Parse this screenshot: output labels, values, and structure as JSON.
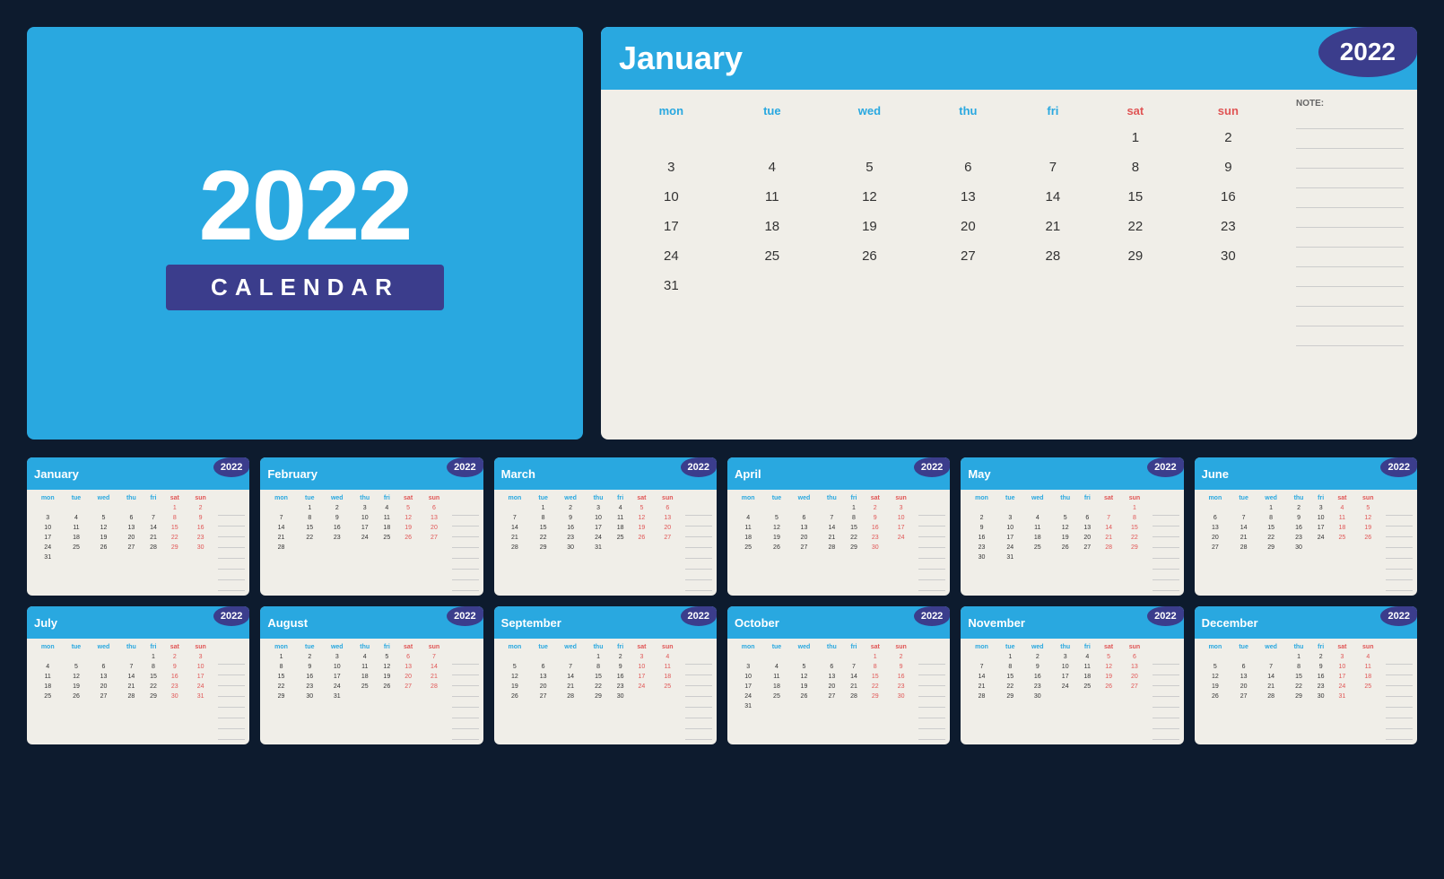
{
  "cover": {
    "year": "2022",
    "label": "CALENDAR"
  },
  "january_large": {
    "month": "January",
    "year": "2022",
    "note_label": "NOTE:",
    "days_header": [
      "mon",
      "tue",
      "wed",
      "thu",
      "fri",
      "sat",
      "sun"
    ],
    "weeks": [
      [
        "",
        "",
        "",
        "",
        "",
        "1",
        "2"
      ],
      [
        "3",
        "4",
        "5",
        "6",
        "7",
        "8",
        "9"
      ],
      [
        "10",
        "11",
        "12",
        "13",
        "14",
        "15",
        "16"
      ],
      [
        "17",
        "18",
        "19",
        "20",
        "21",
        "22",
        "23"
      ],
      [
        "24",
        "25",
        "26",
        "27",
        "28",
        "29",
        "30"
      ],
      [
        "31",
        "",
        "",
        "",
        "",
        "",
        ""
      ]
    ]
  },
  "months": [
    {
      "name": "January",
      "year": "2022",
      "weeks": [
        [
          "",
          "",
          "",
          "",
          "",
          "1",
          "2"
        ],
        [
          "3",
          "4",
          "5",
          "6",
          "7",
          "8",
          "9"
        ],
        [
          "10",
          "11",
          "12",
          "13",
          "14",
          "15",
          "16"
        ],
        [
          "17",
          "18",
          "19",
          "20",
          "21",
          "22",
          "23"
        ],
        [
          "24",
          "25",
          "26",
          "27",
          "28",
          "29",
          "30"
        ],
        [
          "31",
          "",
          "",
          "",
          "",
          "",
          ""
        ]
      ]
    },
    {
      "name": "February",
      "year": "2022",
      "weeks": [
        [
          "",
          "1",
          "2",
          "3",
          "4",
          "5",
          "6"
        ],
        [
          "7",
          "8",
          "9",
          "10",
          "11",
          "12",
          "13"
        ],
        [
          "14",
          "15",
          "16",
          "17",
          "18",
          "19",
          "20"
        ],
        [
          "21",
          "22",
          "23",
          "24",
          "25",
          "26",
          "27"
        ],
        [
          "28",
          "",
          "",
          "",
          "",
          "",
          ""
        ]
      ]
    },
    {
      "name": "March",
      "year": "2022",
      "weeks": [
        [
          "",
          "1",
          "2",
          "3",
          "4",
          "5",
          "6"
        ],
        [
          "7",
          "8",
          "9",
          "10",
          "11",
          "12",
          "13"
        ],
        [
          "14",
          "15",
          "16",
          "17",
          "18",
          "19",
          "20"
        ],
        [
          "21",
          "22",
          "23",
          "24",
          "25",
          "26",
          "27"
        ],
        [
          "28",
          "29",
          "30",
          "31",
          "",
          "",
          ""
        ]
      ]
    },
    {
      "name": "April",
      "year": "2022",
      "weeks": [
        [
          "",
          "",
          "",
          "",
          "1",
          "2",
          "3"
        ],
        [
          "4",
          "5",
          "6",
          "7",
          "8",
          "9",
          "10"
        ],
        [
          "11",
          "12",
          "13",
          "14",
          "15",
          "16",
          "17"
        ],
        [
          "18",
          "19",
          "20",
          "21",
          "22",
          "23",
          "24"
        ],
        [
          "25",
          "26",
          "27",
          "28",
          "29",
          "30",
          ""
        ]
      ]
    },
    {
      "name": "May",
      "year": "2022",
      "weeks": [
        [
          "",
          "",
          "",
          "",
          "",
          "",
          "1"
        ],
        [
          "2",
          "3",
          "4",
          "5",
          "6",
          "7",
          "8"
        ],
        [
          "9",
          "10",
          "11",
          "12",
          "13",
          "14",
          "15"
        ],
        [
          "16",
          "17",
          "18",
          "19",
          "20",
          "21",
          "22"
        ],
        [
          "23",
          "24",
          "25",
          "26",
          "27",
          "28",
          "29"
        ],
        [
          "30",
          "31",
          "",
          "",
          "",
          "",
          ""
        ]
      ]
    },
    {
      "name": "June",
      "year": "2022",
      "weeks": [
        [
          "",
          "",
          "1",
          "2",
          "3",
          "4",
          "5"
        ],
        [
          "6",
          "7",
          "8",
          "9",
          "10",
          "11",
          "12"
        ],
        [
          "13",
          "14",
          "15",
          "16",
          "17",
          "18",
          "19"
        ],
        [
          "20",
          "21",
          "22",
          "23",
          "24",
          "25",
          "26"
        ],
        [
          "27",
          "28",
          "29",
          "30",
          "",
          "",
          ""
        ]
      ]
    },
    {
      "name": "July",
      "year": "2022",
      "weeks": [
        [
          "",
          "",
          "",
          "",
          "1",
          "2",
          "3"
        ],
        [
          "4",
          "5",
          "6",
          "7",
          "8",
          "9",
          "10"
        ],
        [
          "11",
          "12",
          "13",
          "14",
          "15",
          "16",
          "17"
        ],
        [
          "18",
          "19",
          "20",
          "21",
          "22",
          "23",
          "24"
        ],
        [
          "25",
          "26",
          "27",
          "28",
          "29",
          "30",
          "31"
        ]
      ]
    },
    {
      "name": "August",
      "year": "2022",
      "weeks": [
        [
          "1",
          "2",
          "3",
          "4",
          "5",
          "6",
          "7"
        ],
        [
          "8",
          "9",
          "10",
          "11",
          "12",
          "13",
          "14"
        ],
        [
          "15",
          "16",
          "17",
          "18",
          "19",
          "20",
          "21"
        ],
        [
          "22",
          "23",
          "24",
          "25",
          "26",
          "27",
          "28"
        ],
        [
          "29",
          "30",
          "31",
          "",
          "",
          "",
          ""
        ]
      ]
    },
    {
      "name": "September",
      "year": "2022",
      "weeks": [
        [
          "",
          "",
          "",
          "1",
          "2",
          "3",
          "4"
        ],
        [
          "5",
          "6",
          "7",
          "8",
          "9",
          "10",
          "11"
        ],
        [
          "12",
          "13",
          "14",
          "15",
          "16",
          "17",
          "18"
        ],
        [
          "19",
          "20",
          "21",
          "22",
          "23",
          "24",
          "25"
        ],
        [
          "26",
          "27",
          "28",
          "29",
          "30",
          "",
          ""
        ]
      ]
    },
    {
      "name": "October",
      "year": "2022",
      "weeks": [
        [
          "",
          "",
          "",
          "",
          "",
          "1",
          "2"
        ],
        [
          "3",
          "4",
          "5",
          "6",
          "7",
          "8",
          "9"
        ],
        [
          "10",
          "11",
          "12",
          "13",
          "14",
          "15",
          "16"
        ],
        [
          "17",
          "18",
          "19",
          "20",
          "21",
          "22",
          "23"
        ],
        [
          "24",
          "25",
          "26",
          "27",
          "28",
          "29",
          "30"
        ],
        [
          "31",
          "",
          "",
          "",
          "",
          "",
          ""
        ]
      ]
    },
    {
      "name": "November",
      "year": "2022",
      "weeks": [
        [
          "",
          "1",
          "2",
          "3",
          "4",
          "5",
          "6"
        ],
        [
          "7",
          "8",
          "9",
          "10",
          "11",
          "12",
          "13"
        ],
        [
          "14",
          "15",
          "16",
          "17",
          "18",
          "19",
          "20"
        ],
        [
          "21",
          "22",
          "23",
          "24",
          "25",
          "26",
          "27"
        ],
        [
          "28",
          "29",
          "30",
          "",
          "",
          "",
          ""
        ]
      ]
    },
    {
      "name": "December",
      "year": "2022",
      "weeks": [
        [
          "",
          "",
          "",
          "1",
          "2",
          "3",
          "4"
        ],
        [
          "5",
          "6",
          "7",
          "8",
          "9",
          "10",
          "11"
        ],
        [
          "12",
          "13",
          "14",
          "15",
          "16",
          "17",
          "18"
        ],
        [
          "19",
          "20",
          "21",
          "22",
          "23",
          "24",
          "25"
        ],
        [
          "26",
          "27",
          "28",
          "29",
          "30",
          "31",
          ""
        ]
      ]
    }
  ]
}
